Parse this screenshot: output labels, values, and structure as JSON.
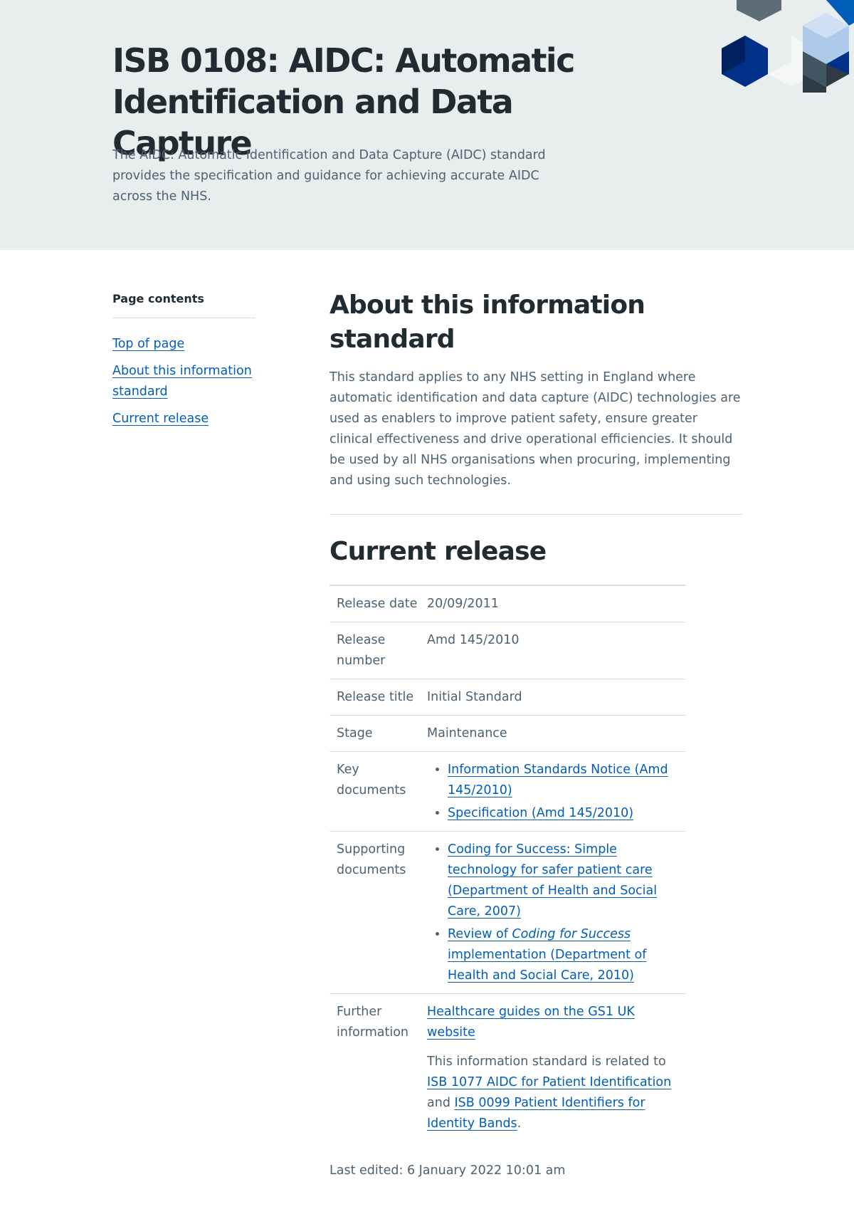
{
  "hero": {
    "title": "ISB 0108: AIDC: Automatic Identification and Data Capture",
    "description": "The AIDC: Automatic Identification and Data Capture (AIDC) standard provides the specification and guidance for achieving accurate AIDC across the NHS."
  },
  "toc": {
    "heading": "Page contents",
    "items": [
      {
        "label": "Top of page"
      },
      {
        "label": "About this information standard"
      },
      {
        "label": "Current release"
      }
    ]
  },
  "about": {
    "heading": "About this information standard",
    "text": "This standard applies to any NHS setting in England where automatic identification and data capture (AIDC) technologies are used as enablers to improve patient safety, ensure greater clinical effectiveness and drive operational efficiencies. It should be used by all NHS organisations when procuring, implementing and using such technologies."
  },
  "release": {
    "heading": "Current release",
    "release_date_label": "Release date",
    "release_date": "20/09/2011",
    "release_number_label": "Release number",
    "release_number": "Amd 145/2010",
    "release_title_label": "Release title",
    "release_title": "Initial Standard",
    "stage_label": "Stage",
    "stage": "Maintenance",
    "key_documents_label": "Key documents",
    "key_documents": [
      {
        "label": "Information Standards Notice (Amd 145/2010)"
      },
      {
        "label": "Specification (Amd 145/2010)"
      }
    ],
    "supporting_documents_label": "Supporting documents",
    "supporting_documents": [
      {
        "label": "Coding for Success: Simple technology for safer patient care (Department of Health and Social Care, 2007)"
      },
      {
        "label_prefix": "Review of ",
        "label_italic": "Coding for Success",
        "label_suffix": " implementation (Department of Health and Social Care, 2010)"
      }
    ],
    "further_information_label": "Further information",
    "further_link": "Healthcare guides on the GS1 UK website",
    "related_prefix": "This information standard is related to ",
    "related_link_1": "ISB 1077 AIDC for Patient Identification",
    "related_middle": " and ",
    "related_link_2": "ISB 0099 Patient Identifiers for Identity Bands",
    "related_suffix": "."
  },
  "footer": {
    "last_edited": "Last edited: 6 January 2022 10:01 am"
  },
  "colors": {
    "link": "#005eb8",
    "hero_background": "#e8edee",
    "text": "#212b32",
    "secondary_text": "#4c6272",
    "border": "#d8dde0"
  }
}
